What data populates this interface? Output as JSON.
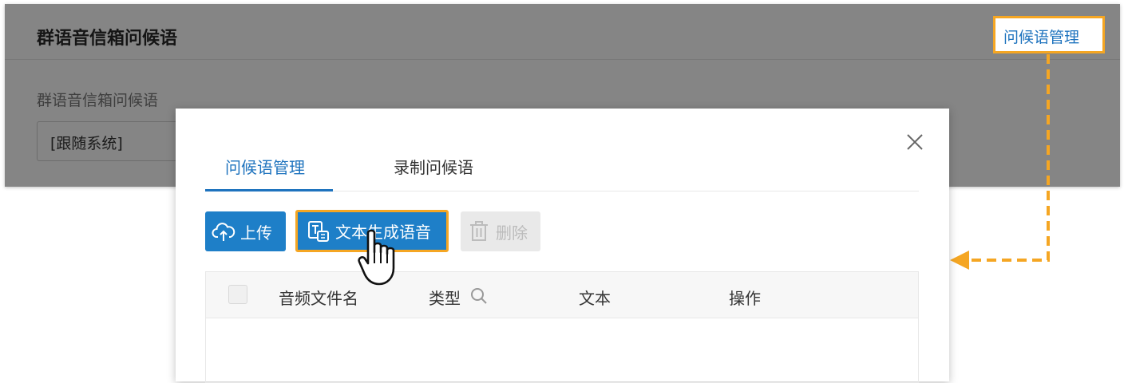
{
  "settings": {
    "section_title": "群语音信箱问候语",
    "field_label": "群语音信箱问候语",
    "field_value": "[跟随系统]"
  },
  "callout": {
    "label": "问候语管理",
    "color": "#f5a623"
  },
  "modal": {
    "tabs": [
      {
        "label": "问候语管理",
        "active": true
      },
      {
        "label": "录制问候语",
        "active": false
      }
    ],
    "toolbar": {
      "upload_label": "上传",
      "upload_icon": "cloud-upload-icon",
      "tts_label": "文本生成语音",
      "tts_icon": "text-to-speech-icon",
      "delete_label": "删除",
      "delete_icon": "trash-icon",
      "delete_disabled": true
    },
    "table": {
      "columns": [
        "音频文件名",
        "类型",
        "文本",
        "操作"
      ],
      "rows": []
    }
  },
  "colors": {
    "accent": "#1e7fc8",
    "highlight": "#f5a623",
    "tab_active": "#1e73be"
  }
}
